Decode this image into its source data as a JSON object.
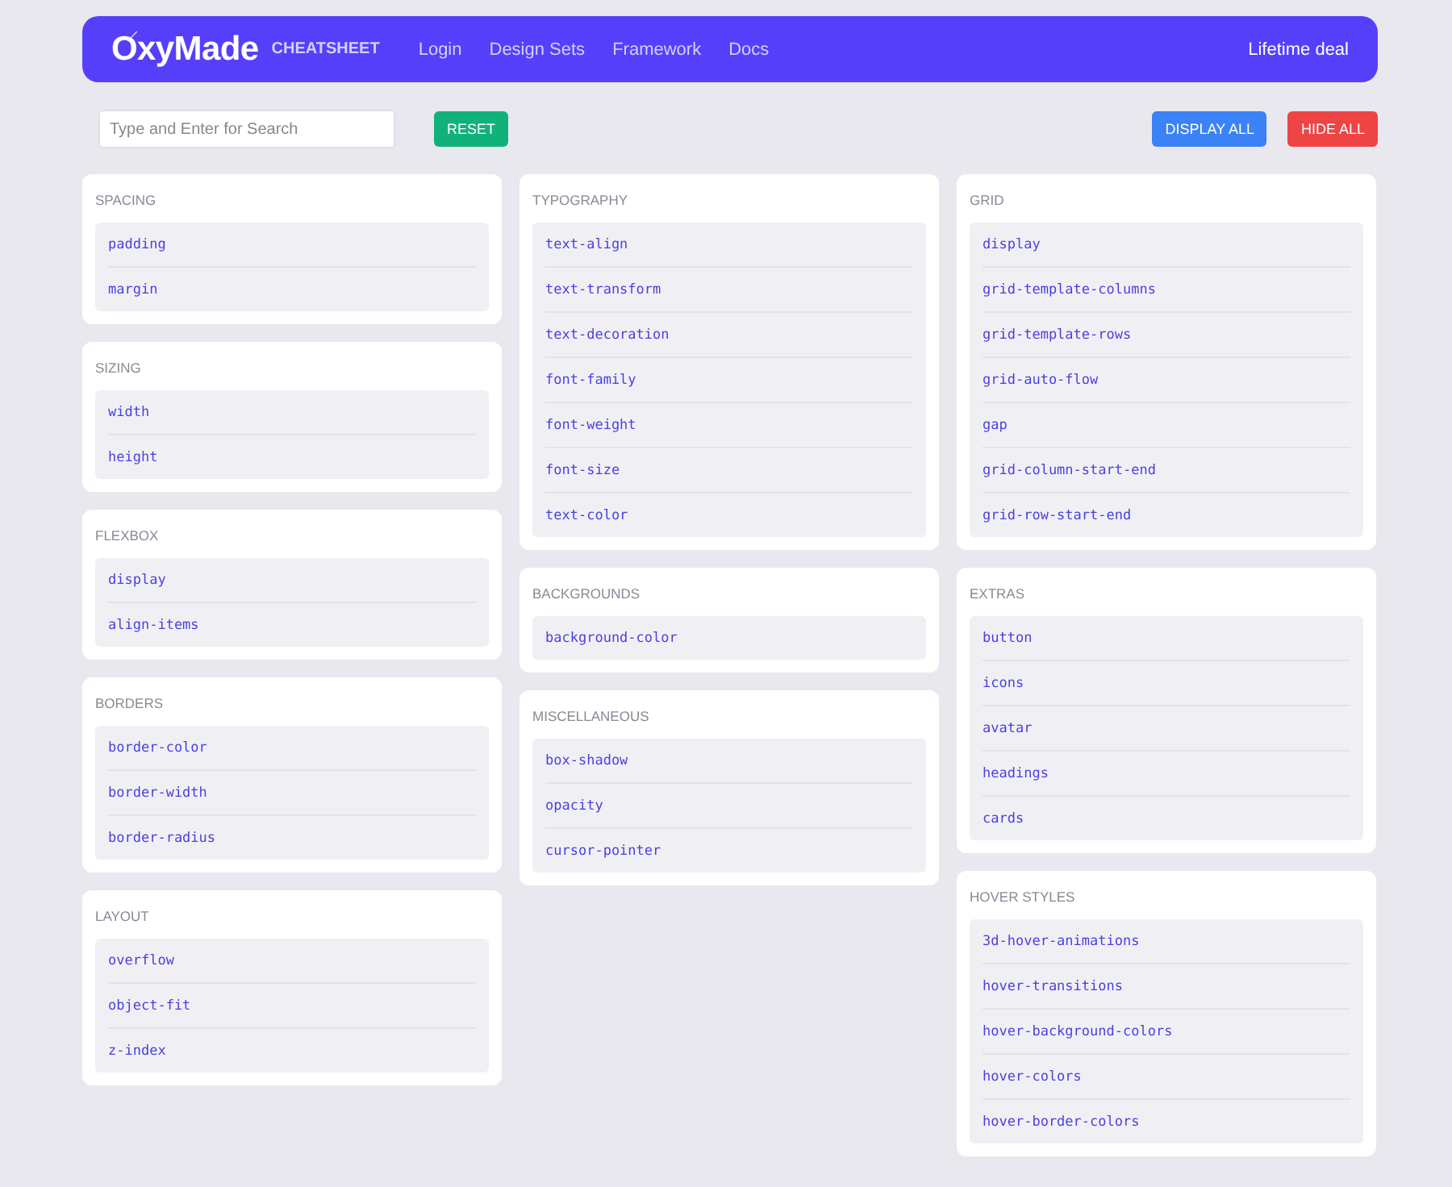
{
  "header": {
    "brand": "OxyMade",
    "subtitle": "CHEATSHEET",
    "nav": [
      "Login",
      "Design Sets",
      "Framework",
      "Docs"
    ],
    "deal": "Lifetime deal"
  },
  "toolbar": {
    "search": {
      "placeholder": "Type and Enter for Search"
    },
    "reset": "RESET",
    "display_all": "DISPLAY ALL",
    "hide_all": "HIDE ALL"
  },
  "columns": [
    [
      {
        "title": "SPACING",
        "items": [
          "padding",
          "margin"
        ]
      },
      {
        "title": "SIZING",
        "items": [
          "width",
          "height"
        ]
      },
      {
        "title": "FLEXBOX",
        "items": [
          "display",
          "align-items"
        ]
      },
      {
        "title": "BORDERS",
        "items": [
          "border-color",
          "border-width",
          "border-radius"
        ]
      },
      {
        "title": "LAYOUT",
        "items": [
          "overflow",
          "object-fit",
          "z-index"
        ]
      }
    ],
    [
      {
        "title": "TYPOGRAPHY",
        "items": [
          "text-align",
          "text-transform",
          "text-decoration",
          "font-family",
          "font-weight",
          "font-size",
          "text-color"
        ]
      },
      {
        "title": "BACKGROUNDS",
        "items": [
          "background-color"
        ]
      },
      {
        "title": "MISCELLANEOUS",
        "items": [
          "box-shadow",
          "opacity",
          "cursor-pointer"
        ]
      }
    ],
    [
      {
        "title": "GRID",
        "items": [
          "display",
          "grid-template-columns",
          "grid-template-rows",
          "grid-auto-flow",
          "gap",
          "grid-column-start-end",
          "grid-row-start-end"
        ]
      },
      {
        "title": "EXTRAS",
        "items": [
          "button",
          "icons",
          "avatar",
          "headings",
          "cards"
        ]
      },
      {
        "title": "HOVER STYLES",
        "items": [
          "3d-hover-animations",
          "hover-transitions",
          "hover-background-colors",
          "hover-colors",
          "hover-border-colors"
        ]
      }
    ]
  ]
}
